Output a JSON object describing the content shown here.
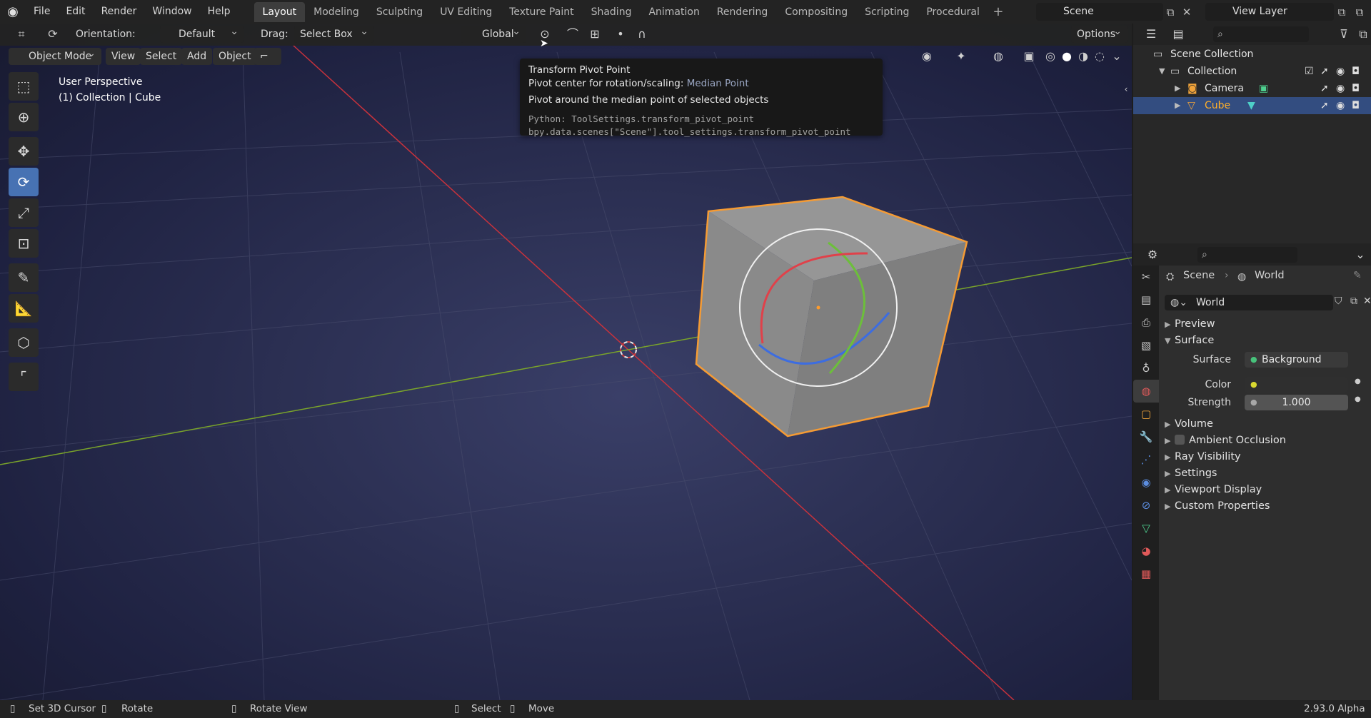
{
  "top_menu": [
    "File",
    "Edit",
    "Render",
    "Window",
    "Help"
  ],
  "workspaces": [
    "Layout",
    "Modeling",
    "Sculpting",
    "UV Editing",
    "Texture Paint",
    "Shading",
    "Animation",
    "Rendering",
    "Compositing",
    "Scripting",
    "Procedural"
  ],
  "scene_name": "Scene",
  "view_layer": "View Layer",
  "header": {
    "orientation_label": "Orientation:",
    "orientation_value": "Default",
    "drag_label": "Drag:",
    "drag_value": "Select Box",
    "transform_orientation": "Global",
    "options": "Options"
  },
  "header2": {
    "mode": "Object Mode",
    "menus": [
      "View",
      "Select",
      "Add",
      "Object"
    ]
  },
  "viewport_info": {
    "line1": "User Perspective",
    "line2": "(1) Collection | Cube"
  },
  "tooltip": {
    "title": "Transform Pivot Point",
    "desc_label": "Pivot center for rotation/scaling:",
    "desc_value": "Median Point",
    "detail": "Pivot around the median point of selected objects",
    "python1": "Python: ToolSettings.transform_pivot_point",
    "python2": "bpy.data.scenes[\"Scene\"].tool_settings.transform_pivot_point"
  },
  "outliner": {
    "root": "Scene Collection",
    "collection": "Collection",
    "items": [
      "Camera",
      "Cube"
    ]
  },
  "properties": {
    "breadcrumb_scene": "Scene",
    "breadcrumb_world": "World",
    "world_name": "World",
    "sections": {
      "preview": "Preview",
      "surface": "Surface",
      "volume": "Volume",
      "ambient_occlusion": "Ambient Occlusion",
      "ray_visibility": "Ray Visibility",
      "settings": "Settings",
      "viewport_display": "Viewport Display",
      "custom_properties": "Custom Properties"
    },
    "surface_label": "Surface",
    "surface_value": "Background",
    "color_label": "Color",
    "strength_label": "Strength",
    "strength_value": "1.000"
  },
  "statusbar": {
    "set_cursor": "Set 3D Cursor",
    "rotate": "Rotate",
    "rotate_view": "Rotate View",
    "select": "Select",
    "move": "Move",
    "version": "2.93.0 Alpha"
  },
  "colors": {
    "accent": "#4772b3",
    "selected_orange": "#ffaf29",
    "x_axis": "#c8323c",
    "y_axis": "#7aa42a"
  }
}
